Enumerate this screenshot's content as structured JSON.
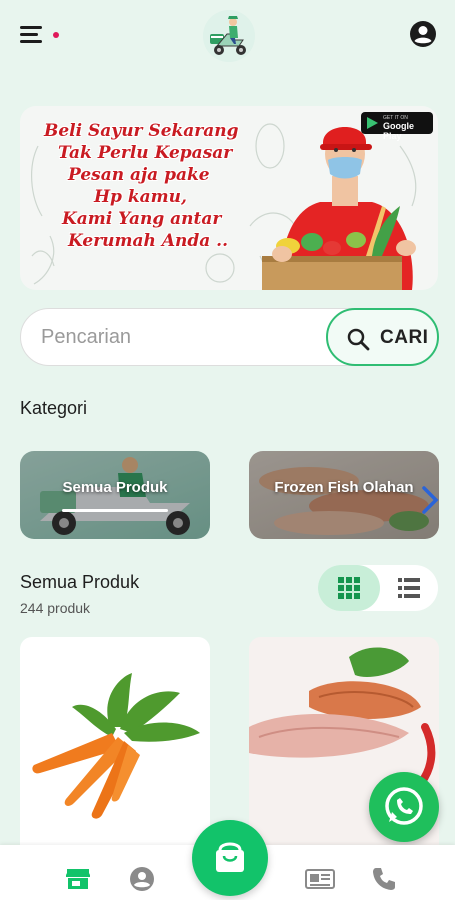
{
  "header": {
    "menu_icon": "hamburger-menu-icon",
    "logo": "delivery-scooter-logo",
    "account_icon": "account-circle-icon",
    "colors": {
      "notification_dot": "#e0195a"
    }
  },
  "banner": {
    "lines": [
      "Beli Sayur Sekarang",
      "Tak Perlu Kepasar",
      "Pesan aja pake",
      "Hp kamu,",
      "Kami Yang antar",
      "Kerumah Anda .."
    ],
    "store_badge_small": "GET IT ON",
    "store_badge": "Google Play"
  },
  "search": {
    "placeholder": "Pencarian",
    "value": "",
    "button_label": "CARI"
  },
  "categories": {
    "title": "Kategori",
    "items": [
      {
        "label": "Semua Produk",
        "selected": true
      },
      {
        "label": "Frozen Fish Olahan",
        "selected": false
      }
    ]
  },
  "products": {
    "title": "Semua Produk",
    "count": "244 produk",
    "view_mode": "grid",
    "items": [
      {
        "image": "carrots"
      },
      {
        "image": "frozen-fish-fillet"
      }
    ]
  },
  "bottom_nav": {
    "items": [
      {
        "icon": "store-icon",
        "active": true
      },
      {
        "icon": "account-icon",
        "active": false
      },
      {
        "icon": "shopping-bag-icon",
        "active": false
      },
      {
        "icon": "news-icon",
        "active": false
      },
      {
        "icon": "phone-icon",
        "active": false
      }
    ]
  },
  "colors": {
    "accent": "#12c36a",
    "background": "#e8f5ee",
    "banner_text": "#c91b22",
    "whatsapp": "#1fbf5c"
  }
}
